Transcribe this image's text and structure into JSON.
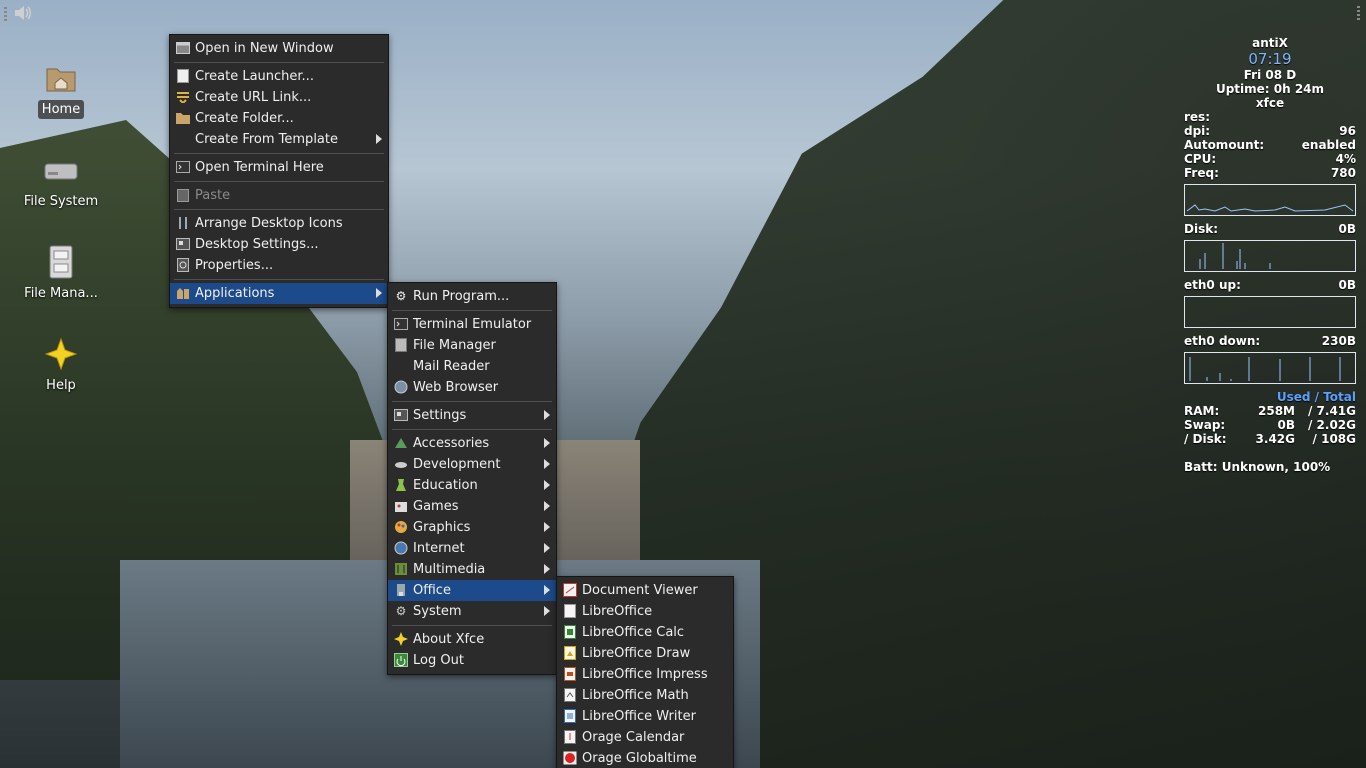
{
  "desktop": {
    "icons": [
      {
        "label": "Home",
        "icon": "home-folder-icon"
      },
      {
        "label": "File System",
        "icon": "drive-icon"
      },
      {
        "label": "File Mana...",
        "icon": "file-cabinet-icon"
      },
      {
        "label": "Help",
        "icon": "help-star-icon"
      }
    ]
  },
  "tray": {
    "volume_icon": "speaker-icon"
  },
  "context_menu": {
    "items": [
      {
        "label": "Open in New Window",
        "icon": "window-icon"
      },
      {
        "label": "Create Launcher...",
        "icon": "document-icon"
      },
      {
        "label": "Create URL Link...",
        "icon": "link-icon"
      },
      {
        "label": "Create Folder...",
        "icon": "folder-icon"
      },
      {
        "label": "Create From Template",
        "icon": ""
      },
      {
        "label": "Open Terminal Here",
        "icon": "terminal-icon"
      },
      {
        "label": "Paste",
        "icon": "clipboard-icon"
      },
      {
        "label": "Arrange Desktop Icons",
        "icon": "arrange-icon"
      },
      {
        "label": "Desktop Settings...",
        "icon": "settings-icon"
      },
      {
        "label": "Properties...",
        "icon": "properties-icon"
      },
      {
        "label": "Applications",
        "icon": "applications-icon"
      }
    ]
  },
  "apps_menu": {
    "items": [
      {
        "label": "Run Program...",
        "icon": "run-icon"
      },
      {
        "label": "Terminal Emulator",
        "icon": "terminal-icon"
      },
      {
        "label": "File Manager",
        "icon": "file-manager-icon"
      },
      {
        "label": "Mail Reader",
        "icon": ""
      },
      {
        "label": "Web Browser",
        "icon": "globe-icon"
      },
      {
        "label": "Settings",
        "icon": "settings-icon"
      },
      {
        "label": "Accessories",
        "icon": "accessories-icon"
      },
      {
        "label": "Development",
        "icon": "development-icon"
      },
      {
        "label": "Education",
        "icon": "education-icon"
      },
      {
        "label": "Games",
        "icon": "games-icon"
      },
      {
        "label": "Graphics",
        "icon": "graphics-icon"
      },
      {
        "label": "Internet",
        "icon": "internet-icon"
      },
      {
        "label": "Multimedia",
        "icon": "multimedia-icon"
      },
      {
        "label": "Office",
        "icon": "office-icon"
      },
      {
        "label": "System",
        "icon": "system-gear-icon"
      },
      {
        "label": "About Xfce",
        "icon": "xfce-star-icon"
      },
      {
        "label": "Log Out",
        "icon": "logout-icon"
      }
    ]
  },
  "office_menu": {
    "items": [
      {
        "label": "Document Viewer",
        "icon": "document-viewer-icon"
      },
      {
        "label": "LibreOffice",
        "icon": "libreoffice-icon"
      },
      {
        "label": "LibreOffice Calc",
        "icon": "calc-icon"
      },
      {
        "label": "LibreOffice Draw",
        "icon": "draw-icon"
      },
      {
        "label": "LibreOffice Impress",
        "icon": "impress-icon"
      },
      {
        "label": "LibreOffice Math",
        "icon": "math-icon"
      },
      {
        "label": "LibreOffice Writer",
        "icon": "writer-icon"
      },
      {
        "label": "Orage Calendar",
        "icon": "calendar-icon"
      },
      {
        "label": "Orage Globaltime",
        "icon": "globaltime-icon"
      }
    ]
  },
  "conky": {
    "host": "antiX",
    "time": "07:19",
    "date": "Fri 08 D",
    "uptime": "Uptime: 0h 24m",
    "wm": "xfce",
    "res_label": "res:",
    "res_value": "",
    "dpi_label": "dpi:",
    "dpi_value": "96",
    "automount_label": "Automount:",
    "automount_value": "enabled",
    "cpu_label": "CPU:",
    "cpu_value": "4%",
    "freq_label": "Freq:",
    "freq_value": "780",
    "disk_label": "Disk:",
    "disk_value": "0B",
    "eth_up_label": "eth0 up:",
    "eth_up_value": "0B",
    "eth_down_label": "eth0 down:",
    "eth_down_value": "230B",
    "used_total": "Used / Total",
    "ram_label": "RAM:",
    "ram_used": "258M",
    "ram_total": "/ 7.41G",
    "swap_label": "Swap:",
    "swap_used": "0B",
    "swap_total": "/ 2.02G",
    "rootdisk_label": "/ Disk:",
    "rootdisk_used": "3.42G",
    "rootdisk_total": "/ 108G",
    "batt": "Batt: Unknown, 100%"
  }
}
